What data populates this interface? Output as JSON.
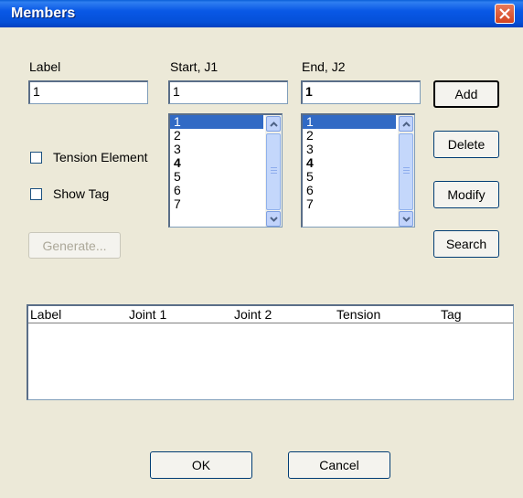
{
  "window": {
    "title": "Members"
  },
  "form": {
    "label": {
      "caption": "Label",
      "value": "1"
    },
    "start": {
      "caption": "Start, J1",
      "value": "1"
    },
    "end": {
      "caption": "End, J2",
      "value": "1"
    }
  },
  "options": {
    "tension_element": {
      "label": "Tension Element",
      "checked": false
    },
    "show_tag": {
      "label": "Show Tag",
      "checked": false
    }
  },
  "buttons": {
    "add": "Add",
    "delete": "Delete",
    "modify": "Modify",
    "search": "Search",
    "generate": "Generate...",
    "ok": "OK",
    "cancel": "Cancel"
  },
  "start_list": {
    "items": [
      "1",
      "2",
      "3",
      "4",
      "5",
      "6",
      "7"
    ],
    "selected": "1"
  },
  "end_list": {
    "items": [
      "1",
      "2",
      "3",
      "4",
      "5",
      "6",
      "7"
    ],
    "selected": "1"
  },
  "members_table": {
    "columns": [
      "Label",
      "Joint 1",
      "Joint 2",
      "Tension",
      "Tag"
    ],
    "rows": []
  },
  "colors": {
    "title_bar": "#0a5fd8",
    "selection": "#316ac5",
    "dialog_bg": "#ece9d8"
  }
}
